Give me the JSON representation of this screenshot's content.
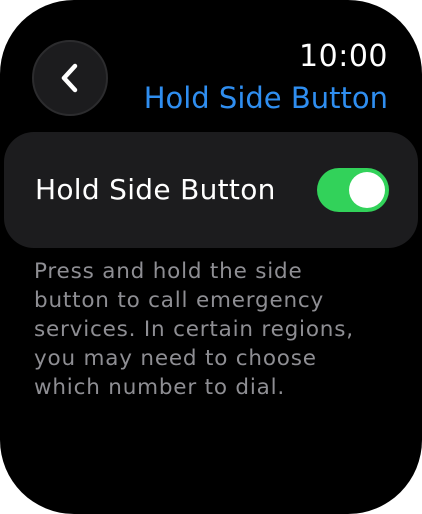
{
  "header": {
    "time": "10:00",
    "title": "Hold Side Button",
    "back_icon": "chevron-left-icon"
  },
  "setting": {
    "label": "Hold Side Button",
    "toggle_on": true,
    "toggle_color": "#32d25a"
  },
  "description": {
    "lines": [
      "Press and hold the side",
      "button to call emergency",
      "services. In certain regions,",
      "you may need to choose",
      "which number to dial."
    ]
  },
  "colors": {
    "accent": "#2f8ef0",
    "background": "#000000",
    "card": "#1c1c1e",
    "secondary_text": "#8e8e93"
  }
}
